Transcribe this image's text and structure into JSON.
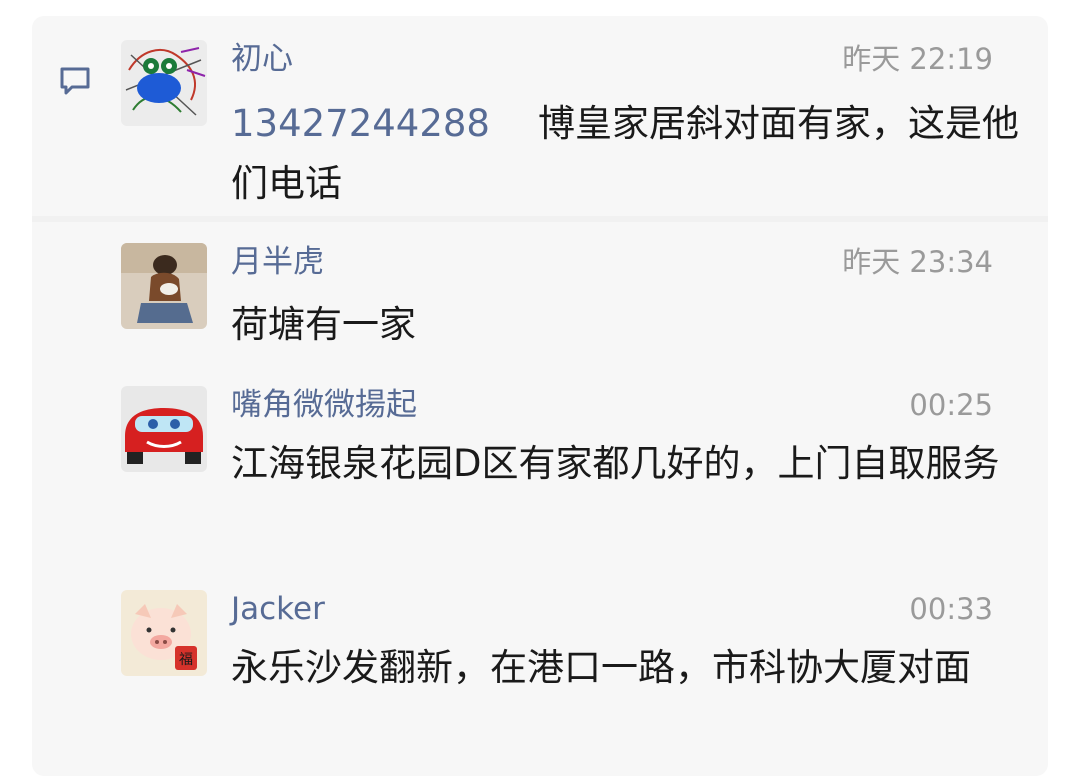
{
  "comments": [
    {
      "name": "初心",
      "time": "昨天 22:19",
      "phone": "13427244288",
      "text": "博皇家居斜对面有家，这是他们电话",
      "avatar": "avatar-scribble-blue-face"
    },
    {
      "name": "月半虎",
      "time": "昨天 23:34",
      "text": "荷塘有一家",
      "avatar": "avatar-person-sitting"
    },
    {
      "name": "嘴角微微揚起",
      "time": "00:25",
      "text": "江海银泉花园D区有家都几好的，上门自取服务",
      "avatar": "avatar-red-race-car"
    },
    {
      "name": "Jacker",
      "time": "00:33",
      "text": "永乐沙发翻新，在港口一路，市科协大厦对面",
      "avatar": "avatar-cartoon-pig-fu"
    }
  ],
  "avatar_badge_char": "福",
  "colors": {
    "name": "#576b95",
    "time": "#9a9a9a",
    "text": "#1a1a1a",
    "panel": "#f7f7f7"
  },
  "icons": {
    "comment_marker": "comment-bubble-icon"
  }
}
